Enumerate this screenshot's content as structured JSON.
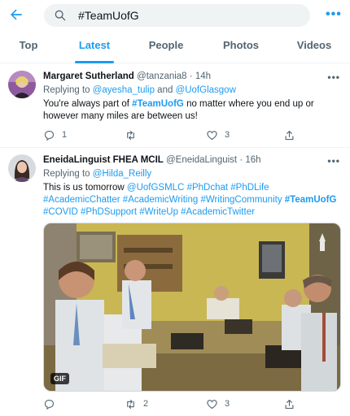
{
  "search": {
    "query": "#TeamUofG"
  },
  "tabs": [
    {
      "label": "Top"
    },
    {
      "label": "Latest"
    },
    {
      "label": "People"
    },
    {
      "label": "Photos"
    },
    {
      "label": "Videos"
    }
  ],
  "active_tab": "Latest",
  "tweets": [
    {
      "name": "Margaret Sutherland",
      "handle": "@tanzania8",
      "time": "· 14h",
      "replying_prefix": "Replying to ",
      "replying_to_1": "@ayesha_tulip",
      "replying_and": " and ",
      "replying_to_2": "@UofGlasgow",
      "text_1": "You're always part of ",
      "tag": "#TeamUofG",
      "text_2": " no matter where you end up or however many miles are between us!",
      "replies": "1",
      "retweets": "",
      "likes": "3"
    },
    {
      "name": "EneidaLinguist FHEA MCIL",
      "handle": "@EneidaLinguist",
      "time": "· 16h",
      "replying_prefix": "Replying to ",
      "replying_to_1": "@Hilda_Reilly",
      "text_1": "This is us tomorrow ",
      "link_1": "@UofGSMLC",
      "tags_line": "#PhDchat #PhDLife",
      "tags_2": "#AcademicChatter #AcademicWriting #WritingCommunity ",
      "tag_bold": "#TeamUofG",
      "tags_3": "#COVID #PhDSupport #WriteUp #AcademicTwitter",
      "media_badge": "GIF",
      "replies": "",
      "retweets": "2",
      "likes": "3"
    }
  ],
  "colors": {
    "accent": "#1d9bf0",
    "text_primary": "#0f1419",
    "text_secondary": "#536471"
  },
  "icons": [
    "back-arrow-icon",
    "search-icon",
    "more-icon",
    "reply-icon",
    "retweet-icon",
    "like-icon",
    "share-icon",
    "caret-icon",
    "gif-badge"
  ]
}
